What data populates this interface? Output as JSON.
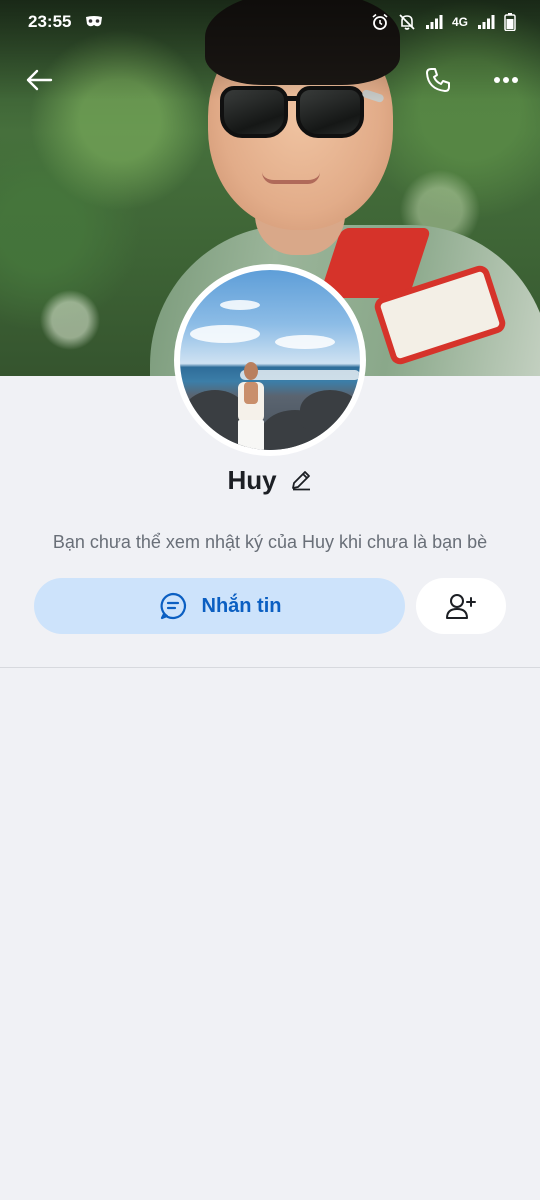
{
  "status_bar": {
    "time": "23:55",
    "network": "4G",
    "icons": [
      "mask-icon",
      "alarm-icon",
      "bell-off-icon",
      "signal-icon",
      "battery-icon"
    ]
  },
  "top_bar": {
    "icons": [
      "back-arrow-icon",
      "phone-icon",
      "more-icon"
    ],
    "icon_color": "#ffffff"
  },
  "profile": {
    "name": "Huy",
    "info_text": "Bạn chưa thể xem nhật ký của Huy khi chưa là bạn bè"
  },
  "actions": {
    "message_label": "Nhắn tin",
    "message_icon": "chat-icon",
    "add_friend_icon": "add-friend-icon"
  },
  "colors": {
    "accent": "#0b5fc2",
    "message_button_bg": "#cde3fb",
    "page_bg": "#f0f1f5"
  }
}
